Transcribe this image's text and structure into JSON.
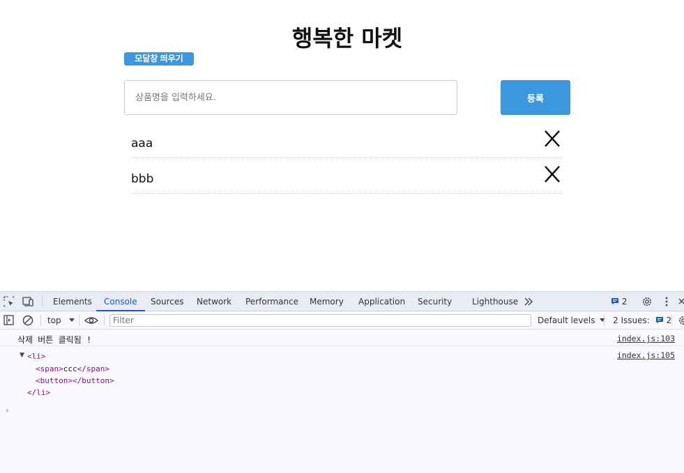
{
  "page": {
    "title": "행복한 마켓",
    "modal_button": "모달창 띄우기",
    "input_placeholder": "상품명을 입력하세요.",
    "register_button": "등록",
    "items": [
      {
        "text": "aaa"
      },
      {
        "text": "bbb"
      }
    ]
  },
  "devtools": {
    "tabs": [
      "Elements",
      "Console",
      "Sources",
      "Network",
      "Performance",
      "Memory",
      "Application",
      "Security",
      "Lighthouse"
    ],
    "active_tab": "Console",
    "message_count": "2",
    "context": "top",
    "filter_placeholder": "Filter",
    "levels": "Default levels",
    "issues_label": "2 Issues:",
    "issues_count": "2",
    "console": {
      "log_text": "삭제 버튼 클릭됨 !",
      "log_source": "index.js:103",
      "tree_source": "index.js:105",
      "tree": {
        "open": "<li>",
        "span_open": "<span>",
        "span_text": "ccc",
        "span_close": "</span>",
        "button": "<button></button>",
        "close": "</li>"
      }
    }
  },
  "colors": {
    "accent": "#3b97de",
    "devtools_active": "#1a56c4",
    "tag": "#881280"
  }
}
